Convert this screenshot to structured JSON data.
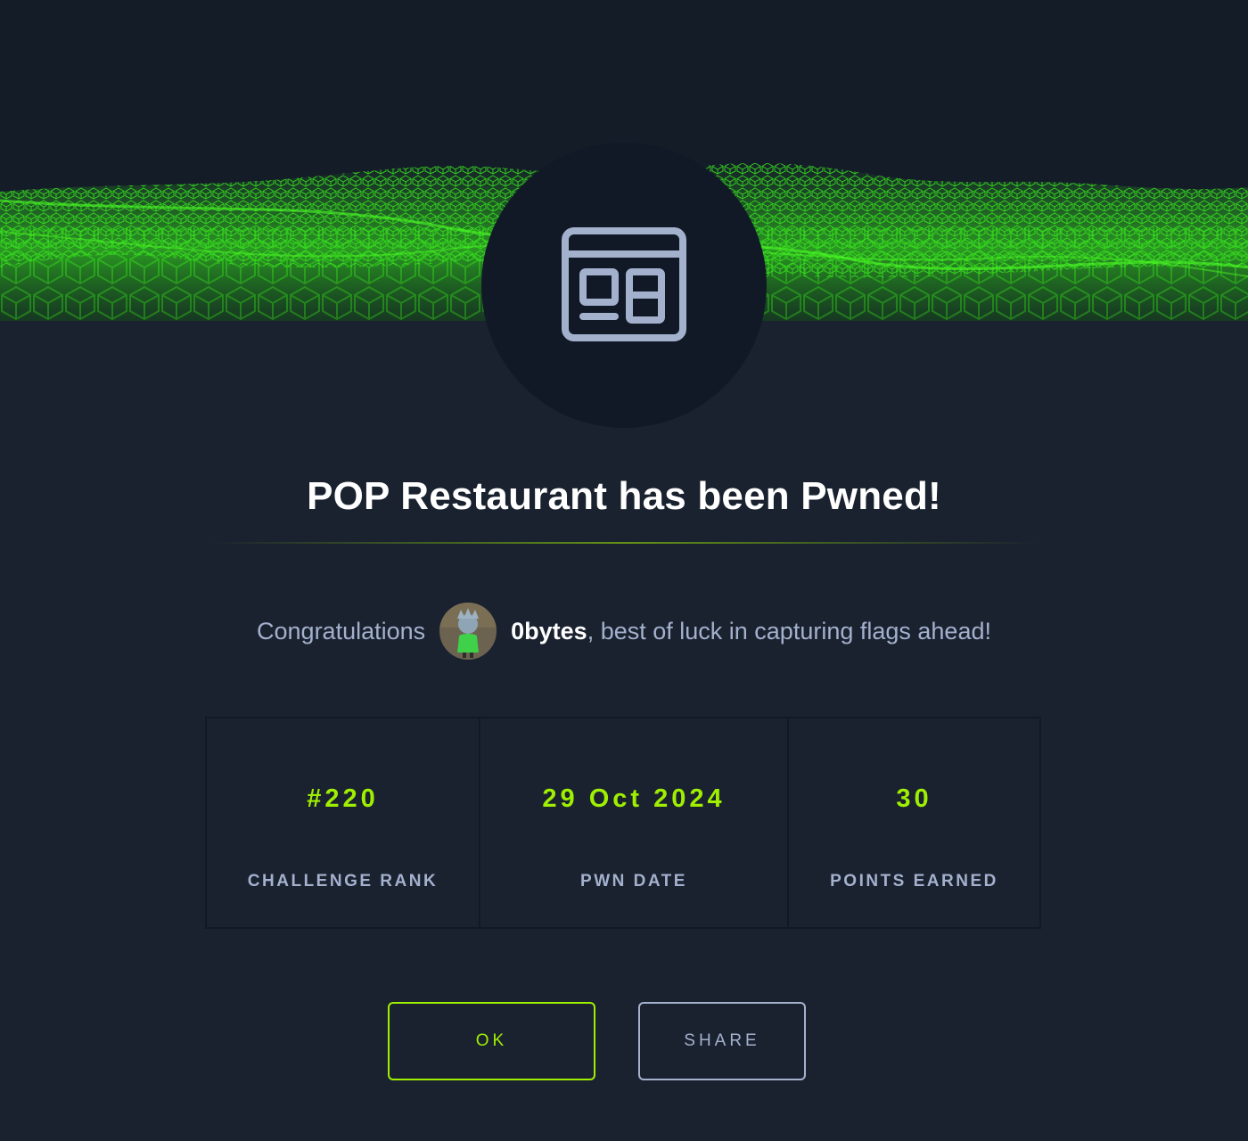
{
  "banner": {
    "icon": "browser-window-icon"
  },
  "title": "POP Restaurant has been Pwned!",
  "congrats": {
    "prefix": "Congratulations",
    "username": "0bytes",
    "suffix": ", best of luck in capturing flags ahead!",
    "avatar_icon": "user-avatar"
  },
  "stats": [
    {
      "value": "#220",
      "label": "CHALLENGE RANK"
    },
    {
      "value": "29 Oct 2024",
      "label": "PWN DATE"
    },
    {
      "value": "30",
      "label": "POINTS EARNED"
    }
  ],
  "buttons": {
    "ok_label": "OK",
    "share_label": "SHARE"
  },
  "colors": {
    "background": "#1a2230",
    "accent": "#9fef00",
    "muted_text": "#a4b1cd",
    "badge_bg": "#111927"
  }
}
